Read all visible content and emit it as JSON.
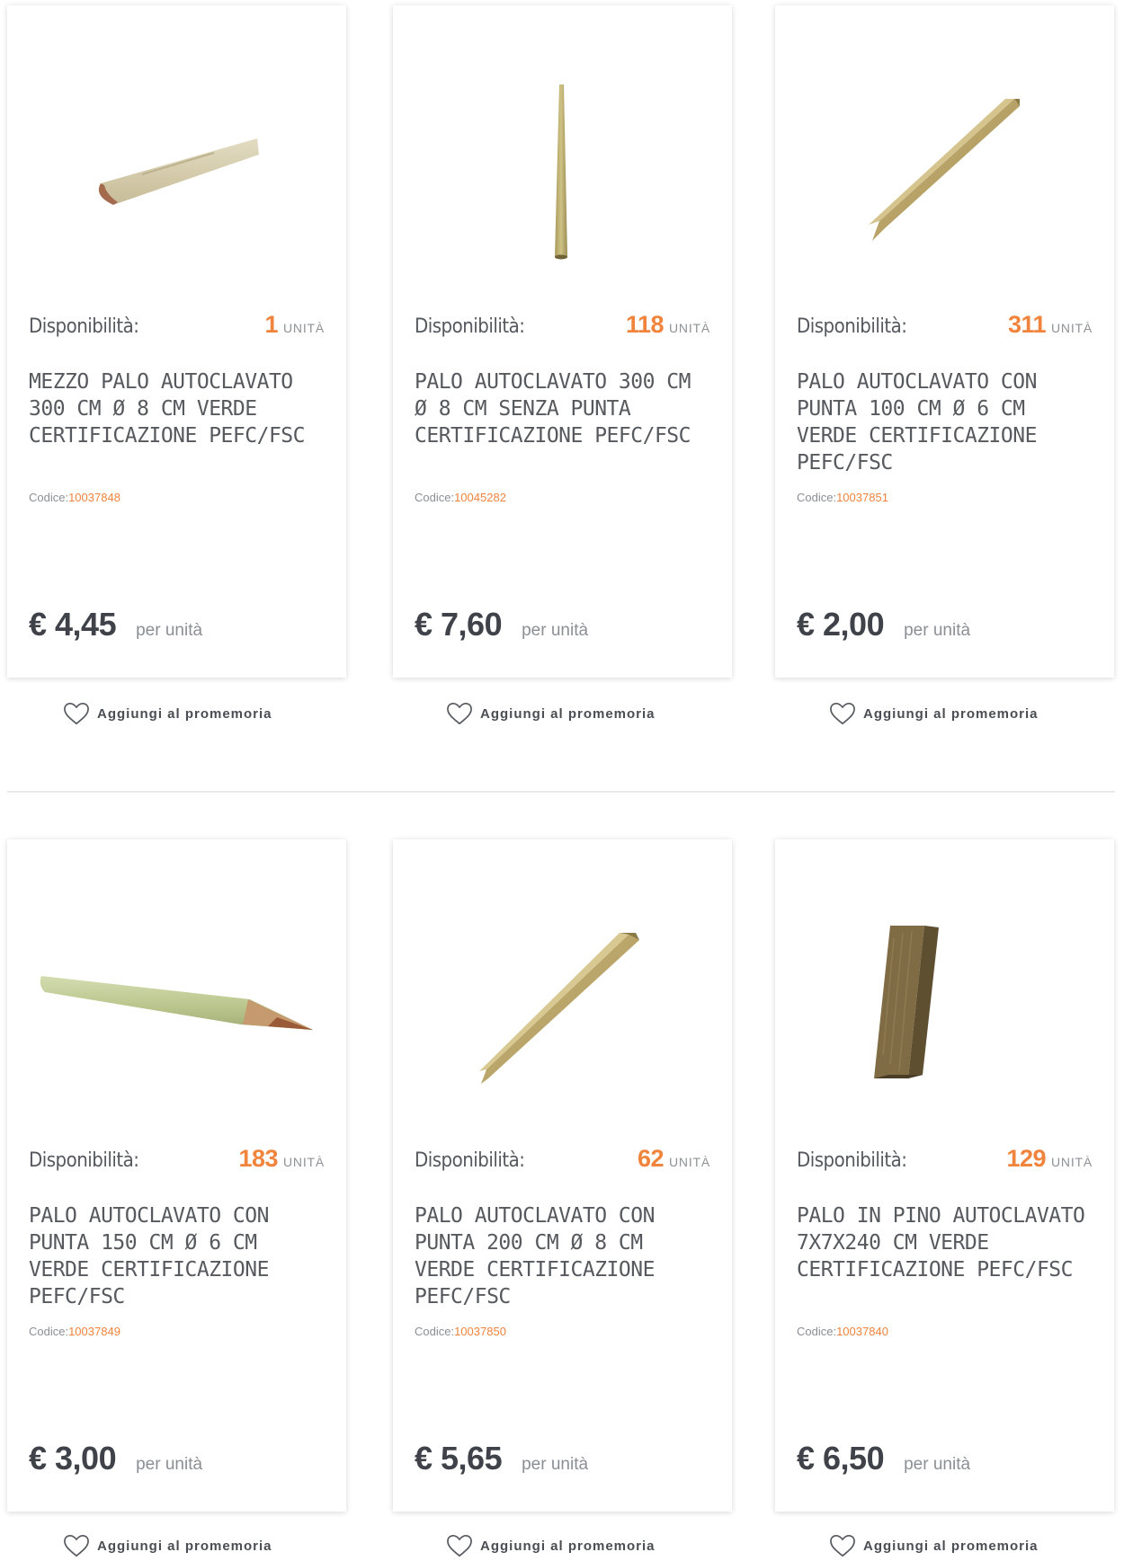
{
  "products": [
    {
      "availability_label": "Disponibilità:",
      "availability_count": "1",
      "availability_unit": "UNITÀ",
      "title": "MEZZO PALO AUTOCLAVATO 300 CM Ø 8 CM VERDE CERTIFICAZIONE PEFC/FSC",
      "code_label": "Codice:",
      "code": "10037848",
      "price": "€ 4,45",
      "price_unit": "per unità",
      "image": "half-pole-image",
      "wishlist_label": "Aggiungi al promemoria"
    },
    {
      "availability_label": "Disponibilità:",
      "availability_count": "118",
      "availability_unit": "UNITÀ",
      "title": "PALO AUTOCLAVATO 300 CM Ø 8 CM SENZA PUNTA CERTIFICAZIONE PEFC/FSC",
      "code_label": "Codice:",
      "code": "10045282",
      "price": "€ 7,60",
      "price_unit": "per unità",
      "image": "vertical-pole-image",
      "wishlist_label": "Aggiungi al promemoria"
    },
    {
      "availability_label": "Disponibilità:",
      "availability_count": "311",
      "availability_unit": "UNITÀ",
      "title": "PALO AUTOCLAVATO CON PUNTA 100 CM Ø 6 CM VERDE CERTIFICAZIONE PEFC/FSC",
      "code_label": "Codice:",
      "code": "10037851",
      "price": "€ 2,00",
      "price_unit": "per unità",
      "image": "pointed-stake-image",
      "wishlist_label": "Aggiungi al promemoria"
    },
    {
      "availability_label": "Disponibilità:",
      "availability_count": "183",
      "availability_unit": "UNITÀ",
      "title": "PALO AUTOCLAVATO CON PUNTA 150 CM Ø 6 CM VERDE CERTIFICAZIONE PEFC/FSC",
      "code_label": "Codice:",
      "code": "10037849",
      "price": "€ 3,00",
      "price_unit": "per unità",
      "image": "horizontal-pointed-pole-image",
      "wishlist_label": "Aggiungi al promemoria"
    },
    {
      "availability_label": "Disponibilità:",
      "availability_count": "62",
      "availability_unit": "UNITÀ",
      "title": "PALO AUTOCLAVATO CON PUNTA 200 CM Ø 8 CM VERDE CERTIFICAZIONE PEFC/FSC",
      "code_label": "Codice:",
      "code": "10037850",
      "price": "€ 5,65",
      "price_unit": "per unità",
      "image": "pointed-stake-image",
      "wishlist_label": "Aggiungi al promemoria"
    },
    {
      "availability_label": "Disponibilità:",
      "availability_count": "129",
      "availability_unit": "UNITÀ",
      "title": "PALO IN PINO AUTOCLAVATO 7X7X240 CM VERDE CERTIFICAZIONE PEFC/FSC",
      "code_label": "Codice:",
      "code": "10037840",
      "price": "€ 6,50",
      "price_unit": "per unità",
      "image": "square-post-image",
      "wishlist_label": "Aggiungi al promemoria"
    }
  ],
  "colors": {
    "accent": "#f0843d",
    "text": "#56595d",
    "price": "#3f4349"
  }
}
